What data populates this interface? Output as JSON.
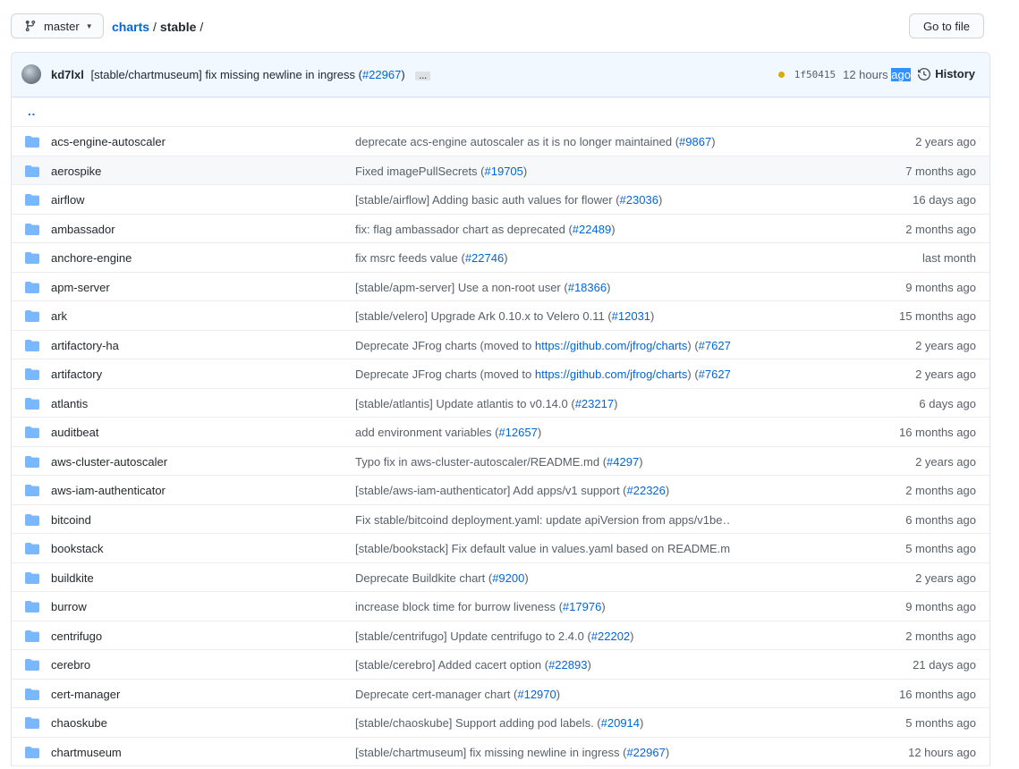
{
  "branch": {
    "label": "master"
  },
  "breadcrumb": {
    "repo": "charts",
    "folder": "stable",
    "sep1": "/",
    "sep2": "/"
  },
  "goto_file": {
    "label": "Go to file"
  },
  "commit": {
    "author": "kd7lxl",
    "message": "[stable/chartmuseum] fix missing newline in ingress (",
    "pr": "#22967",
    "message_end": ")",
    "ellipsis": "…",
    "sha": "1f50415",
    "time_prefix": "12 hours ",
    "time_highlight": "ago",
    "history_label": "History",
    "status_color": "#dbab09"
  },
  "up_dir": {
    "label": ".."
  },
  "rows": [
    {
      "name": "acs-engine-autoscaler",
      "msg": "deprecate acs-engine autoscaler as it is no longer maintained (",
      "pr": "#9867",
      "end": ")",
      "age": "2 years ago"
    },
    {
      "name": "aerospike",
      "msg": "Fixed imagePullSecrets (",
      "pr": "#19705",
      "end": ")",
      "age": "7 months ago"
    },
    {
      "name": "airflow",
      "msg": "[stable/airflow] Adding basic auth values for flower (",
      "pr": "#23036",
      "end": ")",
      "age": "16 days ago"
    },
    {
      "name": "ambassador",
      "msg": "fix: flag ambassador chart as deprecated (",
      "pr": "#22489",
      "end": ")",
      "age": "2 months ago"
    },
    {
      "name": "anchore-engine",
      "msg": "fix msrc feeds value (",
      "pr": "#22746",
      "end": ")",
      "age": "last month"
    },
    {
      "name": "apm-server",
      "msg": "[stable/apm-server] Use a non-root user (",
      "pr": "#18366",
      "end": ")",
      "age": "9 months ago"
    },
    {
      "name": "ark",
      "msg": "[stable/velero] Upgrade Ark 0.10.x to Velero 0.11 (",
      "pr": "#12031",
      "end": ")",
      "age": "15 months ago"
    },
    {
      "name": "artifactory-ha",
      "msg": "Deprecate JFrog charts (moved to ",
      "link": "https://github.com/jfrog/charts",
      "mid": ") (",
      "pr": "#7627",
      "end": "",
      "age": "2 years ago"
    },
    {
      "name": "artifactory",
      "msg": "Deprecate JFrog charts (moved to ",
      "link": "https://github.com/jfrog/charts",
      "mid": ") (",
      "pr": "#7627",
      "end": "",
      "age": "2 years ago"
    },
    {
      "name": "atlantis",
      "msg": "[stable/atlantis] Update atlantis to v0.14.0 (",
      "pr": "#23217",
      "end": ")",
      "age": "6 days ago"
    },
    {
      "name": "auditbeat",
      "msg": "add environment variables (",
      "pr": "#12657",
      "end": ")",
      "age": "16 months ago"
    },
    {
      "name": "aws-cluster-autoscaler",
      "msg": "Typo fix in aws-cluster-autoscaler/README.md (",
      "pr": "#4297",
      "end": ")",
      "age": "2 years ago"
    },
    {
      "name": "aws-iam-authenticator",
      "msg": "[stable/aws-iam-authenticator] Add apps/v1 support (",
      "pr": "#22326",
      "end": ")",
      "age": "2 months ago"
    },
    {
      "name": "bitcoind",
      "msg": "Fix stable/bitcoind deployment.yaml: update apiVersion from apps/v1be…",
      "pr": "",
      "end": "",
      "age": "6 months ago"
    },
    {
      "name": "bookstack",
      "msg": "[stable/bookstack] Fix default value in values.yaml based on README.m…",
      "pr": "",
      "end": "",
      "age": "5 months ago"
    },
    {
      "name": "buildkite",
      "msg": "Deprecate Buildkite chart (",
      "pr": "#9200",
      "end": ")",
      "age": "2 years ago"
    },
    {
      "name": "burrow",
      "msg": "increase block time for burrow liveness (",
      "pr": "#17976",
      "end": ")",
      "age": "9 months ago"
    },
    {
      "name": "centrifugo",
      "msg": "[stable/centrifugo] Update centrifugo to 2.4.0 (",
      "pr": "#22202",
      "end": ")",
      "age": "2 months ago"
    },
    {
      "name": "cerebro",
      "msg": "[stable/cerebro] Added cacert option (",
      "pr": "#22893",
      "end": ")",
      "age": "21 days ago"
    },
    {
      "name": "cert-manager",
      "msg": "Deprecate cert-manager chart (",
      "pr": "#12970",
      "end": ")",
      "age": "16 months ago"
    },
    {
      "name": "chaoskube",
      "msg": "[stable/chaoskube] Support adding pod labels. (",
      "pr": "#20914",
      "end": ")",
      "age": "5 months ago"
    },
    {
      "name": "chartmuseum",
      "msg": "[stable/chartmuseum] fix missing newline in ingress (",
      "pr": "#22967",
      "end": ")",
      "age": "12 hours ago"
    }
  ],
  "colors": {
    "link": "#0366d6",
    "folder": "#79b8ff",
    "hover_row": "#f6f8fa"
  },
  "icons": {
    "branch": "git-branch-icon",
    "folder": "folder-icon",
    "history": "clock-icon"
  }
}
